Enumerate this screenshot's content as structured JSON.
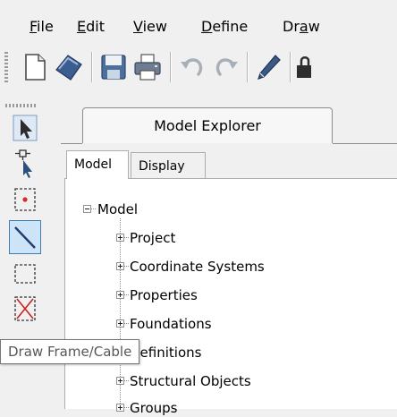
{
  "menu": {
    "items": [
      {
        "pre": "",
        "mnemonic": "F",
        "post": "ile"
      },
      {
        "pre": "",
        "mnemonic": "E",
        "post": "dit"
      },
      {
        "pre": "",
        "mnemonic": "V",
        "post": "iew"
      },
      {
        "pre": "",
        "mnemonic": "D",
        "post": "efine"
      },
      {
        "pre": "Dr",
        "mnemonic": "a",
        "post": "w"
      }
    ]
  },
  "toolbar": {
    "icons": [
      "new-file-icon",
      "open-folder-icon",
      "save-icon",
      "print-icon",
      "undo-icon",
      "redo-icon",
      "pencil-icon",
      "lock-icon"
    ]
  },
  "palette": {
    "tools": [
      "select-pointer-icon",
      "pointer-snap-icon",
      "point-icon",
      "draw-frame-cable-icon",
      "rectangle-select-icon",
      "cross-select-icon"
    ],
    "active_tool": "draw-frame-cable-icon",
    "accent_color": "#3c7fb1"
  },
  "explorer": {
    "title": "Model Explorer",
    "tabs": [
      {
        "label": "Model",
        "active": true
      },
      {
        "label": "Display",
        "active": false
      }
    ],
    "tree": {
      "root": "Model",
      "children": [
        "Project",
        "Coordinate Systems",
        "Properties",
        "Foundations",
        "Definitions",
        "Structural Objects",
        "Groups"
      ]
    }
  },
  "tooltip": {
    "text": "Draw Frame/Cable"
  }
}
